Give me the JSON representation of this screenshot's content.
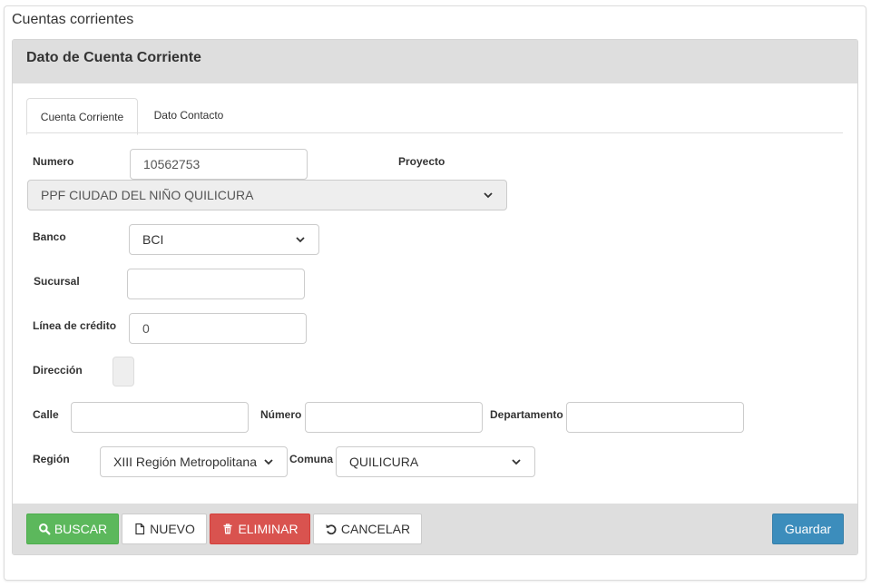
{
  "page": {
    "title": "Cuentas corrientes"
  },
  "panel": {
    "title": "Dato de Cuenta Corriente"
  },
  "tabs": [
    {
      "label": "Cuenta Corriente",
      "active": true
    },
    {
      "label": "Dato Contacto",
      "active": false
    }
  ],
  "form": {
    "numero": {
      "label": "Numero",
      "value": "10562753"
    },
    "proyecto": {
      "label": "Proyecto",
      "selected": "PPF CIUDAD DEL NIÑO QUILICURA"
    },
    "banco": {
      "label": "Banco",
      "selected": "BCI"
    },
    "sucursal": {
      "label": "Sucursal",
      "value": ""
    },
    "linea_credito": {
      "label": "Línea de crédito",
      "value": "0"
    },
    "direccion": {
      "label": "Dirección"
    },
    "calle": {
      "label": "Calle",
      "value": ""
    },
    "numero_dir": {
      "label": "Número",
      "value": ""
    },
    "departamento": {
      "label": "Departamento",
      "value": ""
    },
    "region": {
      "label": "Región",
      "selected": "XIII Región Metropolitana"
    },
    "comuna": {
      "label": "Comuna",
      "selected": "QUILICURA"
    }
  },
  "buttons": {
    "buscar": "BUSCAR",
    "nuevo": "NUEVO",
    "eliminar": "ELIMINAR",
    "cancelar": "CANCELAR",
    "guardar": "Guardar"
  },
  "colors": {
    "success": "#5cb85c",
    "danger": "#d9534f",
    "primary": "#3c8dbc",
    "panel_header": "#dedede"
  },
  "icons": {
    "buscar": "search-icon",
    "nuevo": "file-icon",
    "eliminar": "trash-icon",
    "cancelar": "undo-icon",
    "select": "chevron-down-icon"
  }
}
